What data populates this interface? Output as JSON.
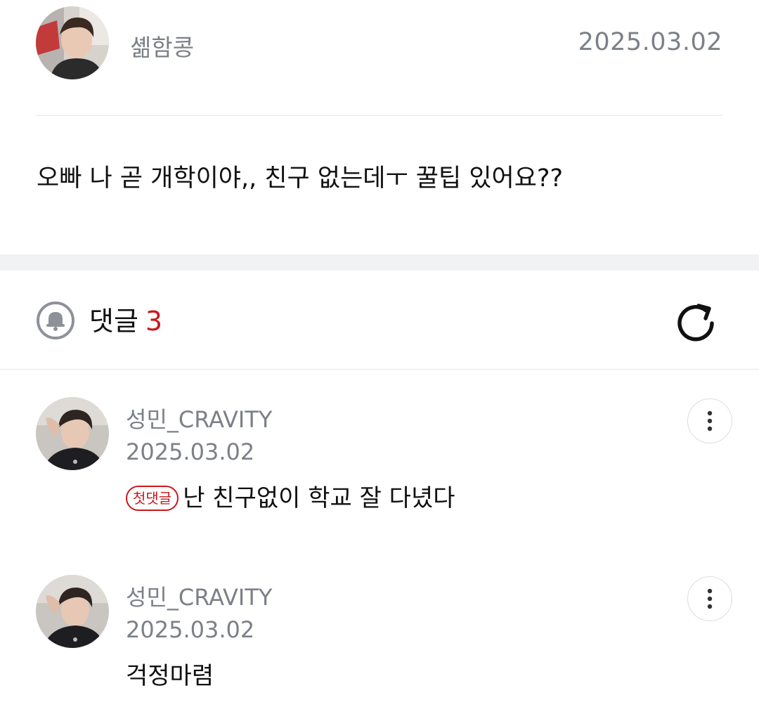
{
  "post": {
    "author": "셺함콩",
    "date": "2025.03.02",
    "body": "오빠 나 곧 개학이야,, 친구 없는데ㅜ 꿀팁 있어요??"
  },
  "comments_section": {
    "title": "댓글",
    "count": "3",
    "icon": "bell-icon",
    "refresh_icon": "refresh-icon"
  },
  "comments": [
    {
      "author": "성민_CRAVITY",
      "date": "2025.03.02",
      "badge": "첫댓글",
      "text": "난 친구없이 학교 잘 다녔다"
    },
    {
      "author": "성민_CRAVITY",
      "date": "2025.03.02",
      "text": "걱정마렴"
    }
  ],
  "colors": {
    "accent_red": "#c8181e",
    "meta_gray": "#7c8087",
    "divider": "#e6e7ea",
    "section_gap": "#f1f2f4"
  }
}
